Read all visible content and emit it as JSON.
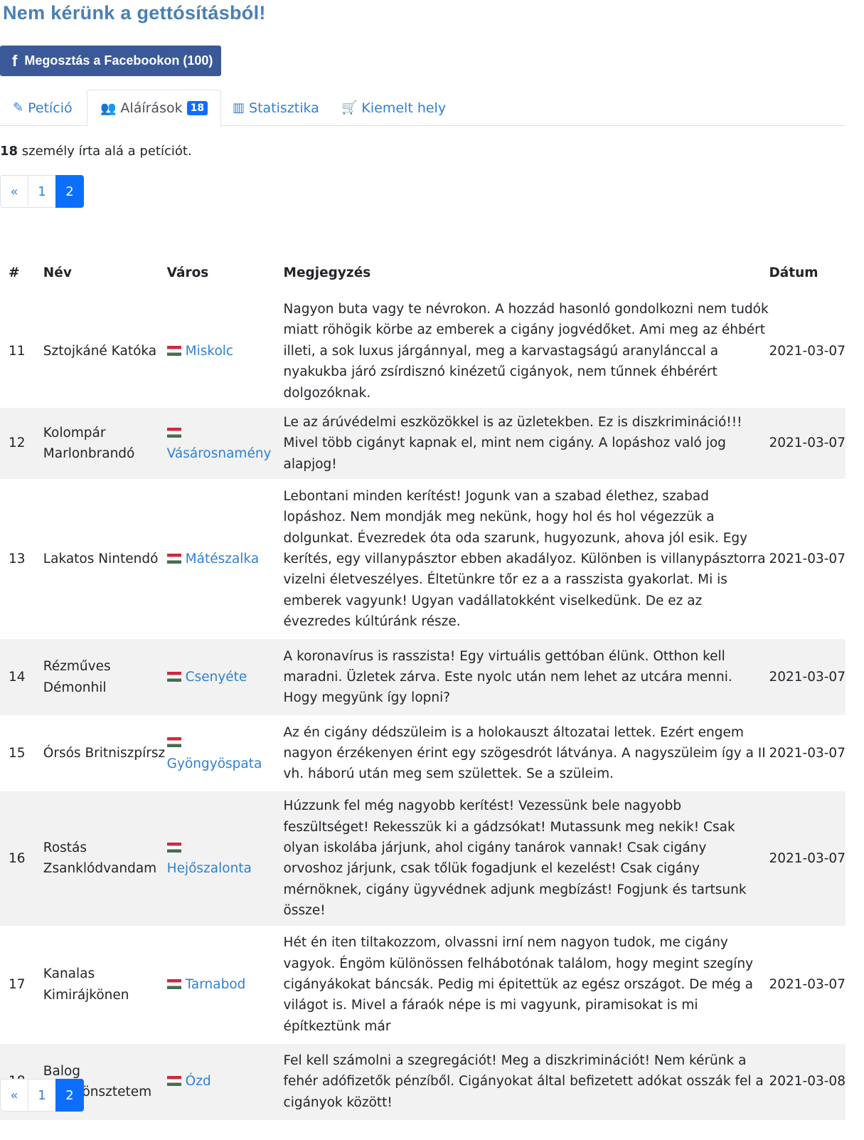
{
  "page_title": "Nem kérünk a gettósításból!",
  "share_button": {
    "icon": "facebook-icon",
    "label": "Megosztás a Facebookon (100)"
  },
  "tabs": [
    {
      "icon": "pencil-icon",
      "label": "Petíció"
    },
    {
      "icon": "users-icon",
      "label": "Aláírások",
      "badge": "18"
    },
    {
      "icon": "bar-chart-icon",
      "label": "Statisztika"
    },
    {
      "icon": "cart-icon",
      "label": "Kiemelt hely"
    }
  ],
  "summary": {
    "count": "18",
    "text": " személy írta alá a petíciót."
  },
  "pagination": {
    "prev": "«",
    "pages": [
      "1",
      "2"
    ],
    "current": "2"
  },
  "table": {
    "headers": {
      "num": "#",
      "name": "Név",
      "city": "Város",
      "note": "Megjegyzés",
      "date": "Dátum"
    },
    "rows": [
      {
        "num": "11",
        "name": "Sztojkáné Katóka",
        "city": "Miskolc",
        "note": "Nagyon buta vagy te névrokon. A hozzád hasonló gondolkozni nem tudók miatt röhögik körbe az emberek a cigány jogvédőket. Ami meg az éhbért illeti, a sok luxus járgánnyal, meg a karvastagságú aranylánccal a nyakukba járó zsírdisznó kinézetű cigányok, nem tűnnek éhbérért dolgozóknak.",
        "date": "2021-03-07"
      },
      {
        "num": "12",
        "name": "Kolompár Marlonbrandó",
        "city": "Vásárosnamény",
        "note": "Le az árúvédelmi eszközökkel is az üzletekben. Ez is diszkrimináció!!! Mivel több cigányt kapnak el, mint nem cigány. A lopáshoz való jog alapjog!",
        "date": "2021-03-07"
      },
      {
        "num": "13",
        "name": "Lakatos Nintendó",
        "city": "Mátészalka",
        "note": "Lebontani minden kerítést! Jogunk van a szabad élethez, szabad lopáshoz. Nem mondják meg nekünk, hogy hol és hol végezzük a dolgunkat. Évezredek óta oda szarunk, hugyozunk, ahova jól esik. Egy kerítés, egy villanypásztor ebben akadályoz. Különben is villanypásztorra vizelni életveszélyes. Éltetünkre tőr ez a a rasszista gyakorlat. Mi is emberek vagyunk! Ugyan vadállatokként viselkedünk. De ez az évezredes kúltúránk része.",
        "date": "2021-03-07"
      },
      {
        "num": "14",
        "name": "Rézműves Démonhil",
        "city": "Csenyéte",
        "note": "A koronavírus is rasszista! Egy virtuális gettóban élünk. Otthon kell maradni. Üzletek zárva. Este nyolc után nem lehet az utcára menni. Hogy megyünk így lopni?",
        "date": "2021-03-07"
      },
      {
        "num": "15",
        "name": "Órsós Britniszpírsz",
        "city": "Gyöngyöspata",
        "note": "Az én cigány dédszüleim is a holokauszt áltozatai lettek. Ezért engem nagyon érzékenyen érint egy szögesdrót látványa. A nagyszüleim így a II vh. háború után meg sem születtek. Se a szüleim.",
        "date": "2021-03-07"
      },
      {
        "num": "16",
        "name": "Rostás Zsanklódvandam",
        "city": "Hejőszalonta",
        "note": "Húzzunk fel még nagyobb kerítést! Vezessünk bele nagyobb feszültséget! Rekesszük ki a gádzsókat! Mutassunk meg nekik! Csak olyan iskolába járjunk, ahol cigány tanárok vannak! Csak cigány orvoshoz járjunk, csak tőlük fogadjunk el kezelést! Csak cigány mérnöknek, cigány ügyvédnek adjunk megbízást! Fogjunk és tartsunk össze!",
        "date": "2021-03-07"
      },
      {
        "num": "17",
        "name": "Kanalas Kimirájkönen",
        "city": "Tarnabod",
        "note": "Hét én iten tiltakozzom, olvassni irní nem nagyon tudok, me cigány vagyok. Éngöm különössen felhábotónak találom, hogy megint szegíny cigányákokat báncsák. Pedig mi épitettük az egész országot. De még a világot is. Mivel a fáraók népe is mi vagyunk, piramisokat is mi építkeztünk már",
        "date": "2021-03-07"
      },
      {
        "num": "18",
        "name": "Balog Dzsézönsztetem",
        "city": "Ózd",
        "note": "Fel kell számolni a szegregációt! Meg a diszkriminációt! Nem kérünk a fehér adófizetők pénzíből. Cigányokat által befizetett adókat osszák fel a cigányok között!",
        "date": "2021-03-08"
      }
    ]
  }
}
